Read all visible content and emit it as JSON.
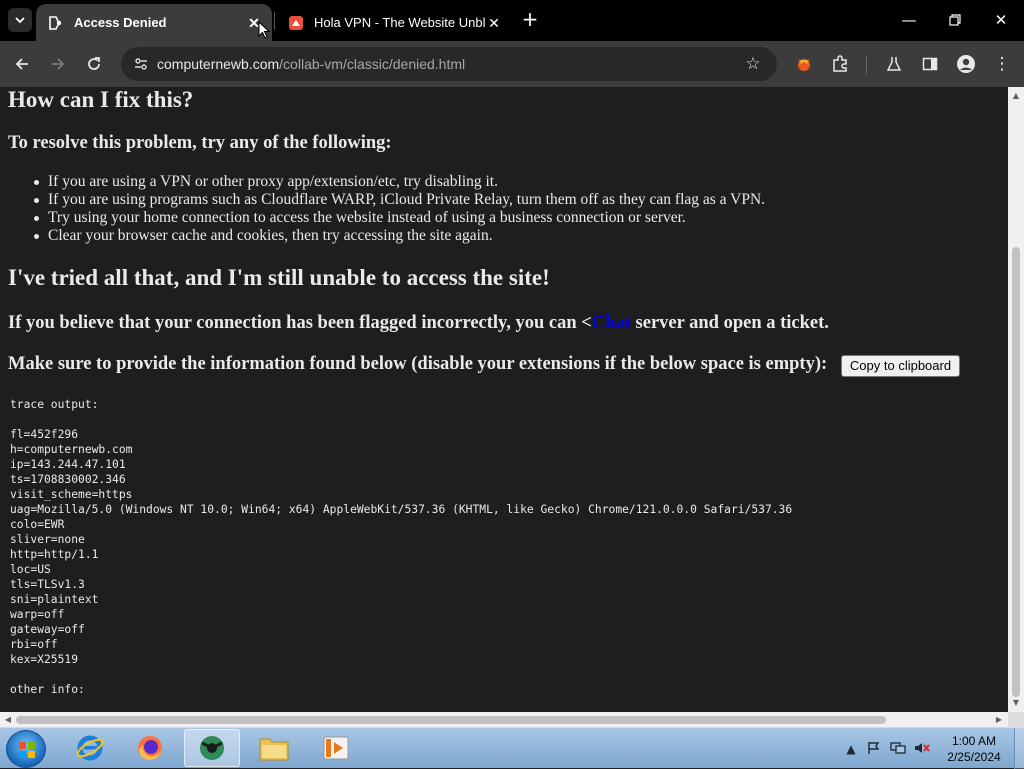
{
  "browser": {
    "tabs": [
      {
        "title": "Access Denied",
        "active": true
      },
      {
        "title": "Hola VPN - The Website Unbloc",
        "active": false
      }
    ],
    "address_bar": {
      "host": "computernewb.com",
      "path": "/collab-vm/classic/denied.html"
    }
  },
  "page": {
    "heading_fix": "How can I fix this?",
    "resolve_intro": "To resolve this problem, try any of the following:",
    "suggestions": [
      "If you are using a VPN or other proxy app/extension/etc, try disabling it.",
      "If you are using programs such as Cloudflare WARP, iCloud Private Relay, turn them off as they can flag as a VPN.",
      "Try using your home connection to access the website instead of using a business connection or server.",
      "Clear your browser cache and cookies, then try accessing the site again."
    ],
    "heading_still": "I've tried all that, and I'm still unable to access the site!",
    "flagged_before": "If you believe that your connection has been flagged incorrectly, you can <",
    "flagged_link": "Chat",
    "flagged_after": " server and open a ticket.",
    "provide_info": "Make sure to provide the information found below (disable your extensions if the below space is empty):",
    "copy_button": "Copy to clipboard",
    "trace_output": "trace output:\n\nfl=452f296\nh=computernewb.com\nip=143.244.47.101\nts=1708830002.346\nvisit_scheme=https\nuag=Mozilla/5.0 (Windows NT 10.0; Win64; x64) AppleWebKit/537.36 (KHTML, like Gecko) Chrome/121.0.0.0 Safari/537.36\ncolo=EWR\nsliver=none\nhttp=http/1.1\nloc=US\ntls=TLSv1.3\nsni=plaintext\nwarp=off\ngateway=off\nrbi=off\nkex=X25519\n\nother info:"
  },
  "taskbar": {
    "apps": [
      "internet-explorer",
      "firefox",
      "chrome",
      "file-explorer",
      "media-player"
    ],
    "time": "1:00 AM",
    "date": "2/25/2024"
  },
  "colors": {
    "page_bg": "#1e1e1e",
    "page_text": "#eaeaea",
    "link": "#0000ee",
    "tabstrip_bg": "#000000",
    "toolbar_bg": "#3c3c3c"
  }
}
